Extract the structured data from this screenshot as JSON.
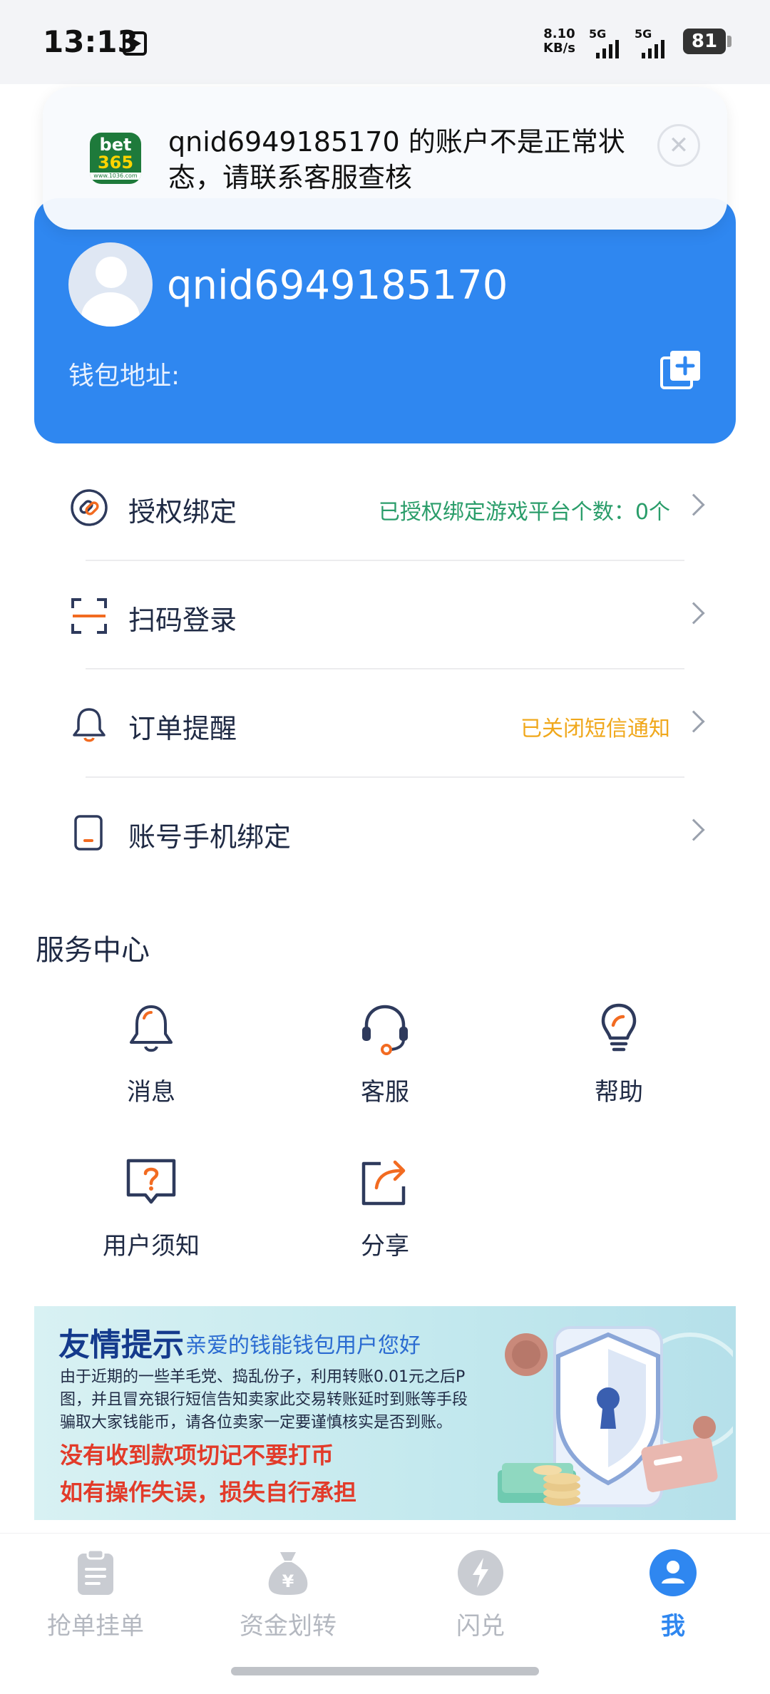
{
  "status_bar": {
    "time": "13:13",
    "net_speed_value": "8.10",
    "net_speed_unit": "KB/s",
    "sim1_label": "5G",
    "sim2_label": "5G",
    "battery": "81"
  },
  "notification": {
    "app_logo_line1": "bet",
    "app_logo_line2": "365",
    "app_logo_line3": "www.1036.com",
    "message": "qnid6949185170 的账户不是正常状态，请联系客服查核",
    "close_icon": "close-icon"
  },
  "profile": {
    "username": "qnid6949185170",
    "wallet_label": "钱包地址:",
    "copy_icon": "copy-add-icon",
    "bg_color": "#2f87f0"
  },
  "menu": [
    {
      "icon": "link-icon",
      "label": "授权绑定",
      "value": "已授权绑定游戏平台个数：0个",
      "value_color": "#2a9d6a"
    },
    {
      "icon": "scan-icon",
      "label": "扫码登录",
      "value": ""
    },
    {
      "icon": "bell-icon",
      "label": "订单提醒",
      "value": "已关闭短信通知",
      "value_color": "#f0a81c"
    },
    {
      "icon": "phone-icon",
      "label": "账号手机绑定",
      "value": ""
    }
  ],
  "service_center": {
    "title": "服务中心",
    "items": [
      {
        "icon": "message-bell-icon",
        "label": "消息"
      },
      {
        "icon": "headset-icon",
        "label": "客服"
      },
      {
        "icon": "lightbulb-icon",
        "label": "帮助"
      },
      {
        "icon": "question-icon",
        "label": "用户须知"
      },
      {
        "icon": "share-icon",
        "label": "分享"
      }
    ]
  },
  "promo": {
    "title": "友情提示",
    "subtitle": "亲爱的钱能钱包用户您好",
    "body": "由于近期的一些羊毛党、捣乱份子，利用转账0.01元之后P图，并且冒充银行短信告知卖家此交易转账延时到账等手段骗取大家钱能币，请各位卖家一定要谨慎核实是否到账。",
    "warning1": "没有收到款项切记不要打币",
    "warning2": "如有操作失误，损失自行承担"
  },
  "bottom_nav": [
    {
      "icon": "clipboard-icon",
      "label": "抢单挂单",
      "active": false
    },
    {
      "icon": "money-bag-icon",
      "label": "资金划转",
      "active": false
    },
    {
      "icon": "lightning-icon",
      "label": "闪兑",
      "active": false
    },
    {
      "icon": "user-icon",
      "label": "我",
      "active": true
    }
  ],
  "colors": {
    "accent": "#2f87f0",
    "success": "#2a9d6a",
    "warning": "#f0a81c",
    "icon_orange": "#f26b21"
  }
}
